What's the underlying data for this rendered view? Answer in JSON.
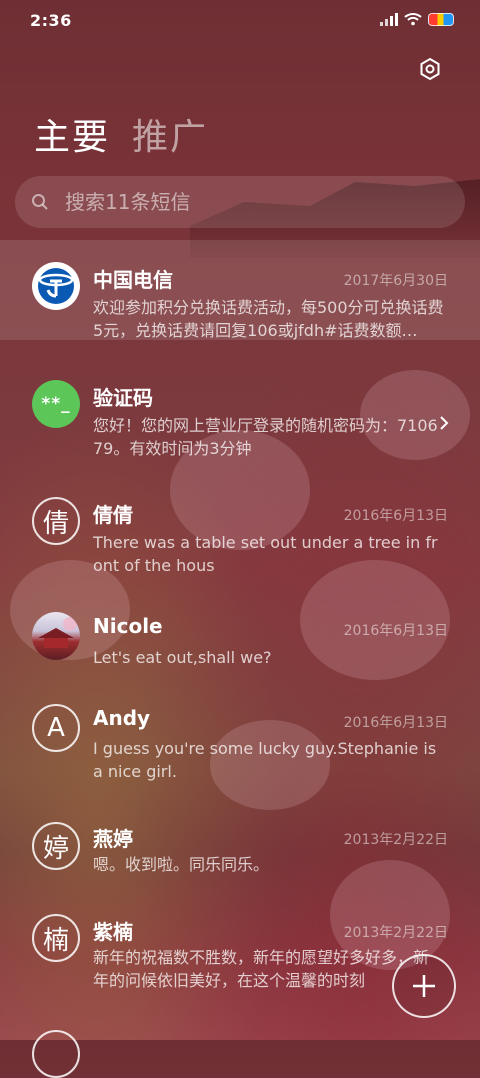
{
  "status_bar": {
    "time": "2:36"
  },
  "tabs": [
    {
      "label": "主要",
      "active": true
    },
    {
      "label": "推广",
      "active": false
    }
  ],
  "search": {
    "placeholder": "搜索11条短信"
  },
  "conversations": [
    {
      "name": "中国电信",
      "date": "2017年6月30日",
      "preview": "欢迎参加积分兑换话费活动，每500分可兑换话费5元，兑换话费请回复106或jfdh#话费数额…",
      "avatar": "china-telecom-logo"
    },
    {
      "name": "验证码",
      "date": "",
      "preview": "您好！您的网上营业厅登录的随机密码为：710679。有效时间为3分钟",
      "avatar_text": "**_"
    },
    {
      "name": "倩倩",
      "date": "2016年6月13日",
      "preview": "There was a table set out under a tree in front of the hous",
      "avatar_text": "倩"
    },
    {
      "name": "Nicole",
      "date": "2016年6月13日",
      "preview": "Let's eat out,shall we?",
      "avatar": "photo"
    },
    {
      "name": "Andy",
      "date": "2016年6月13日",
      "preview": "I guess you're some lucky guy.Stephanie is a nice girl.",
      "avatar_text": "A"
    },
    {
      "name": "燕婷",
      "date": "2013年2月22日",
      "preview": "嗯。收到啦。同乐同乐。",
      "avatar_text": "婷"
    },
    {
      "name": "紫楠",
      "date": "2013年2月22日",
      "preview": "新年的祝福数不胜数，新年的愿望好多好多，新年的问候依旧美好，在这个温馨的时刻",
      "avatar_text": "楠"
    }
  ],
  "colors": {
    "telecom_blue": "#0a5ab4",
    "verify_green": "#5cc659"
  }
}
